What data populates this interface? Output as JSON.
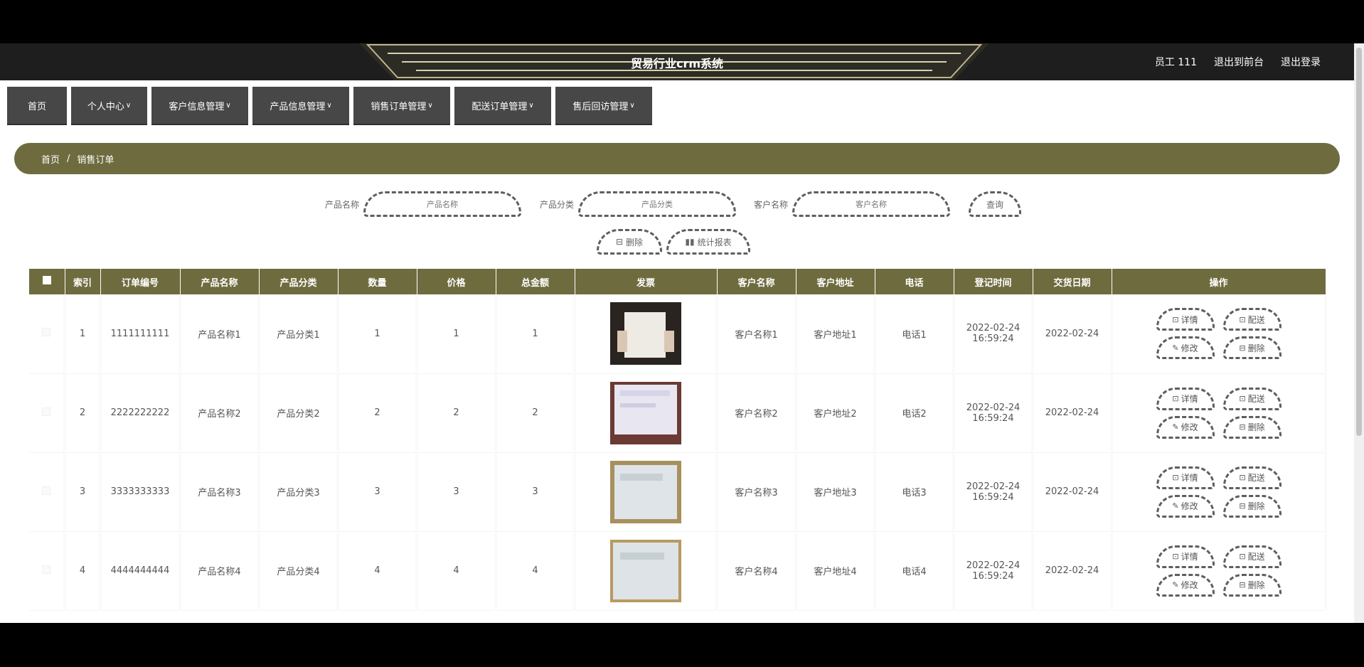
{
  "header": {
    "title": "贸易行业crm系统",
    "user": "员工 111",
    "to_front": "退出到前台",
    "logout": "退出登录"
  },
  "nav": [
    {
      "label": "首页",
      "chev": ""
    },
    {
      "label": "个人中心",
      "chev": "∨"
    },
    {
      "label": "客户信息管理",
      "chev": "∨"
    },
    {
      "label": "产品信息管理",
      "chev": "∨"
    },
    {
      "label": "销售订单管理",
      "chev": "∨"
    },
    {
      "label": "配送订单管理",
      "chev": "∨"
    },
    {
      "label": "售后回访管理",
      "chev": "∨"
    }
  ],
  "breadcrumb": {
    "home": "首页",
    "sep": "/",
    "current": "销售订单"
  },
  "search": {
    "product_name_label": "产品名称",
    "product_name_placeholder": "产品名称",
    "category_label": "产品分类",
    "category_placeholder": "产品分类",
    "customer_label": "客户名称",
    "customer_placeholder": "客户名称",
    "query": "查询",
    "delete": "删除",
    "stats": "统计报表"
  },
  "table": {
    "columns": [
      "索引",
      "订单编号",
      "产品名称",
      "产品分类",
      "数量",
      "价格",
      "总金额",
      "发票",
      "客户名称",
      "客户地址",
      "电话",
      "登记时间",
      "交货日期",
      "操作"
    ],
    "ops": {
      "detail": "详情",
      "deliver": "配送",
      "edit": "修改",
      "delete": "删除"
    },
    "rows": [
      {
        "index": "1",
        "order_no": "1111111111",
        "product": "产品名称1",
        "category": "产品分类1",
        "qty": "1",
        "price": "1",
        "total": "1",
        "customer": "客户名称1",
        "address": "客户地址1",
        "phone": "电话1",
        "reg_date": "2022-02-24",
        "reg_time": "16:59:24",
        "delivery": "2022-02-24"
      },
      {
        "index": "2",
        "order_no": "2222222222",
        "product": "产品名称2",
        "category": "产品分类2",
        "qty": "2",
        "price": "2",
        "total": "2",
        "customer": "客户名称2",
        "address": "客户地址2",
        "phone": "电话2",
        "reg_date": "2022-02-24",
        "reg_time": "16:59:24",
        "delivery": "2022-02-24"
      },
      {
        "index": "3",
        "order_no": "3333333333",
        "product": "产品名称3",
        "category": "产品分类3",
        "qty": "3",
        "price": "3",
        "total": "3",
        "customer": "客户名称3",
        "address": "客户地址3",
        "phone": "电话3",
        "reg_date": "2022-02-24",
        "reg_time": "16:59:24",
        "delivery": "2022-02-24"
      },
      {
        "index": "4",
        "order_no": "4444444444",
        "product": "产品名称4",
        "category": "产品分类4",
        "qty": "4",
        "price": "4",
        "total": "4",
        "customer": "客户名称4",
        "address": "客户地址4",
        "phone": "电话4",
        "reg_date": "2022-02-24",
        "reg_time": "16:59:24",
        "delivery": "2022-02-24"
      }
    ]
  },
  "colors": {
    "accent": "#6e6b3e",
    "nav": "#474747",
    "header": "#1e1e1e"
  }
}
